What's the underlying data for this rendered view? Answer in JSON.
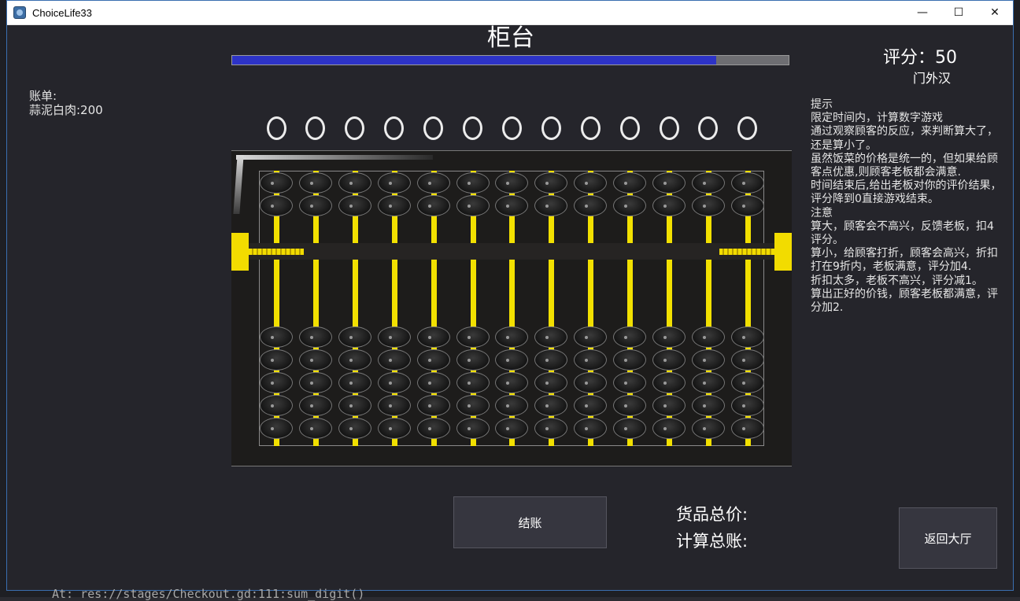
{
  "window": {
    "title": "ChoiceLife33",
    "controls": {
      "minimize": "—",
      "maximize": "☐",
      "close": "✕"
    }
  },
  "console_text": "At: res://stages/Checkout.gd:111:sum_digit()",
  "page": {
    "title": "柜台",
    "progress_fraction": 0.87
  },
  "score": {
    "label": "评分：",
    "value": "50",
    "rank": "门外汉"
  },
  "bill": {
    "label": "账单:",
    "items": [
      "蒜泥白肉:200"
    ]
  },
  "hint": {
    "lines": [
      "提示",
      "限定时间内，计算数字游戏",
      "通过观察顾客的反应，来判断算大了，还是算小了。",
      "虽然饭菜的价格是统一的，但如果给顾客点优惠,则顾客老板都会满意.",
      "时间结束后,给出老板对你的评价结果，评分降到0直接游戏结束。",
      "注意",
      "算大，顾客会不高兴，反馈老板，扣4评分。",
      "算小，给顾客打折，顾客会高兴，折扣打在9折内，老板满意，评分加4.",
      "折扣太多，老板不高兴，评分减1。",
      "算出正好的价钱，顾客老板都满意，评分加2."
    ]
  },
  "digits": [
    "0",
    "0",
    "0",
    "0",
    "0",
    "0",
    "0",
    "0",
    "0",
    "0",
    "0",
    "0",
    "0"
  ],
  "abacus": {
    "rods": 13,
    "upper_beads_per_rod": 2,
    "lower_beads_per_rod": 5
  },
  "buttons": {
    "checkout": "结账",
    "back_to_lobby": "返回大厅"
  },
  "totals": {
    "goods_total_label": "货品总价:",
    "computed_total_label": "计算总账:"
  },
  "colors": {
    "progress_fill": "#2d33c6",
    "rod": "#f2e000",
    "background": "#25252b"
  }
}
